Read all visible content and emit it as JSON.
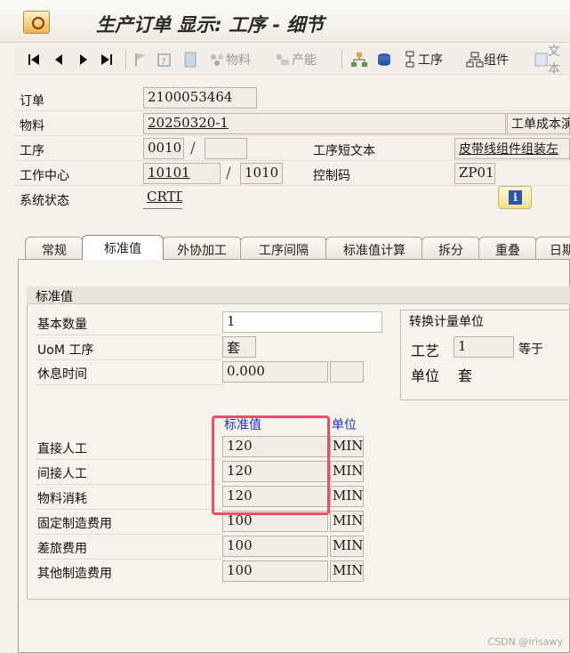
{
  "title": "生产订单 显示: 工序 - 细节",
  "toolbar": {
    "material": "物料",
    "capacity": "产能",
    "operation": "工序",
    "component": "组件",
    "document": "文本"
  },
  "header": {
    "order_label": "订单",
    "order_value": "2100053464",
    "material_label": "物料",
    "material_value": "20250320-1",
    "material_desc": "工单成本演",
    "operation_label": "工序",
    "operation_value": "0010",
    "operation_sub": "",
    "short_text_label": "工序短文本",
    "short_text_value": "皮带线组件组装左",
    "work_center_label": "工作中心",
    "work_center_value": "10101",
    "plant_value": "1010",
    "control_key_label": "控制码",
    "control_key_value": "ZP01",
    "system_status_label": "系统状态",
    "system_status_value": "CRTD"
  },
  "tabs": [
    "常规",
    "标准值",
    "外协加工",
    "工序间隔",
    "标准值计算",
    "拆分",
    "重叠",
    "日期"
  ],
  "standard_values": {
    "group_title": "标准值",
    "base_qty_label": "基本数量",
    "base_qty_value": "1",
    "uom_label": "UoM 工序",
    "uom_value": "套",
    "break_label": "休息时间",
    "break_value": "0.000",
    "col_value": "标准值",
    "col_unit": "单位",
    "rows": [
      {
        "label": "直接人工",
        "value": "120",
        "unit": "MIN"
      },
      {
        "label": "间接人工",
        "value": "120",
        "unit": "MIN"
      },
      {
        "label": "物料消耗",
        "value": "120",
        "unit": "MIN"
      },
      {
        "label": "固定制造费用",
        "value": "100",
        "unit": "MIN"
      },
      {
        "label": "差旅费用",
        "value": "100",
        "unit": "MIN"
      },
      {
        "label": "其他制造费用",
        "value": "100",
        "unit": "MIN"
      }
    ]
  },
  "conversion": {
    "title": "转换计量单位",
    "process_label": "工艺",
    "process_value": "1",
    "equals": "等于",
    "unit_label": "单位",
    "unit_value": "套"
  },
  "watermark": "CSDN @irisawy",
  "colors": {
    "highlight": "#e8506a",
    "unit_header": "#1a33c8"
  }
}
